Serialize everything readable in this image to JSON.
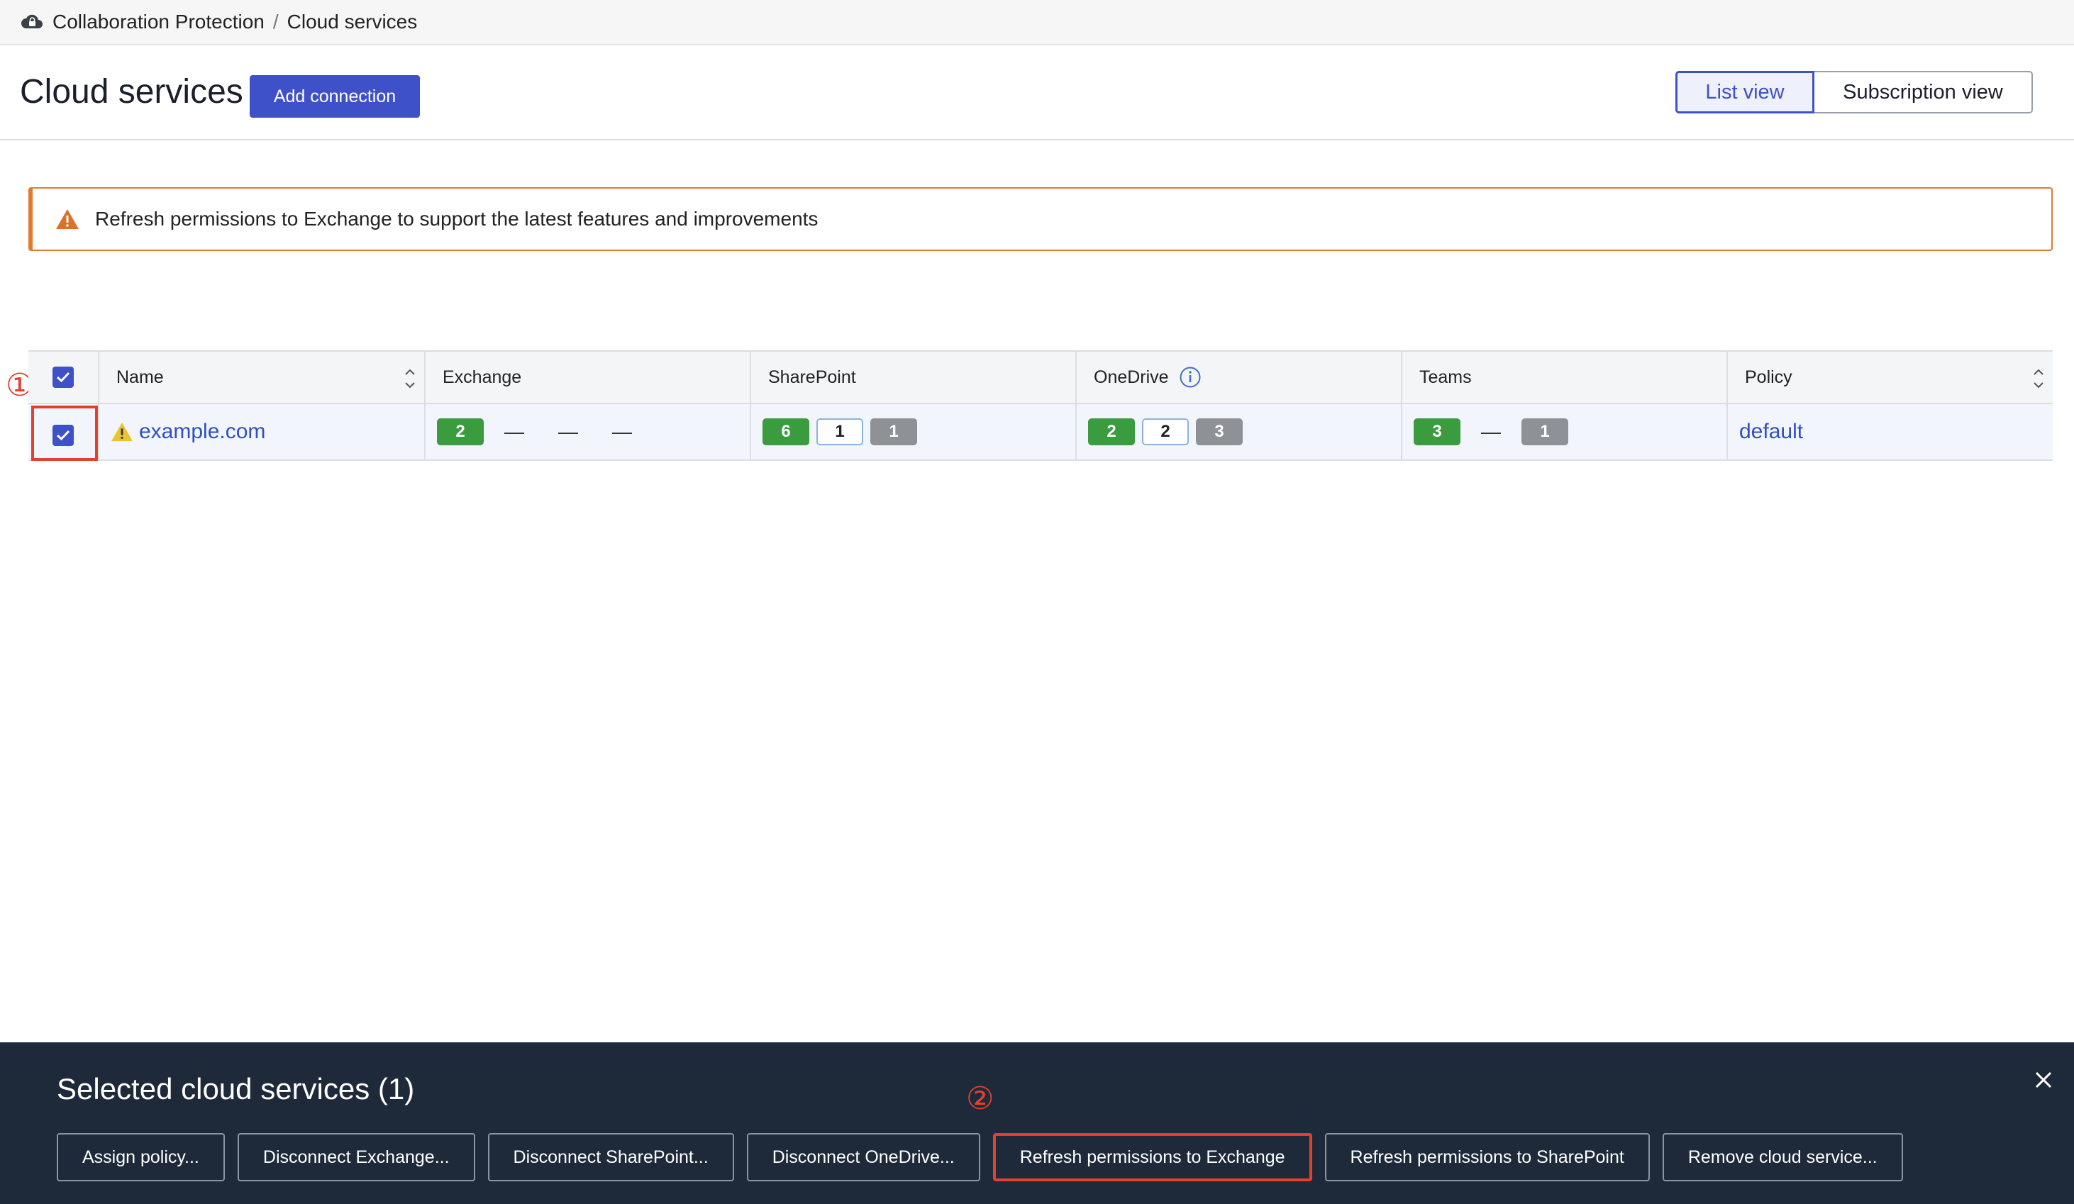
{
  "breadcrumb": {
    "icon": "cloud-lock-icon",
    "parent": "Collaboration Protection",
    "separator": "/",
    "current": "Cloud services"
  },
  "header": {
    "title": "Cloud services",
    "add_button": "Add connection",
    "view_list": "List view",
    "view_subscription": "Subscription view",
    "active_view": "List view"
  },
  "banner": {
    "icon": "warning-icon",
    "text": "Refresh permissions to Exchange to support the latest features and improvements"
  },
  "table": {
    "columns": [
      "Name",
      "Exchange",
      "SharePoint",
      "OneDrive",
      "Teams",
      "Policy"
    ],
    "rows": [
      {
        "selected": true,
        "name": "example.com",
        "exchange": [
          "2",
          "—",
          "—",
          "—"
        ],
        "sharepoint": [
          "6",
          "1",
          "1"
        ],
        "onedrive": [
          "2",
          "2",
          "3"
        ],
        "teams": [
          "3",
          "—",
          "1"
        ],
        "policy": "default"
      }
    ]
  },
  "annotations": {
    "step1": "①",
    "step2": "②"
  },
  "action_bar": {
    "title": "Selected cloud services (1)",
    "buttons": [
      "Assign policy...",
      "Disconnect Exchange...",
      "Disconnect SharePoint...",
      "Disconnect OneDrive...",
      "Refresh permissions to Exchange",
      "Refresh permissions to SharePoint",
      "Remove cloud service..."
    ],
    "highlighted": "Refresh permissions to Exchange"
  },
  "colors": {
    "accent": "#3f51c8",
    "warning": "#e07a2e",
    "highlight": "#e0422f",
    "green_badge": "#3a9b3f",
    "gray_badge": "#8e9196",
    "action_bar_bg": "#1e2a3a"
  }
}
